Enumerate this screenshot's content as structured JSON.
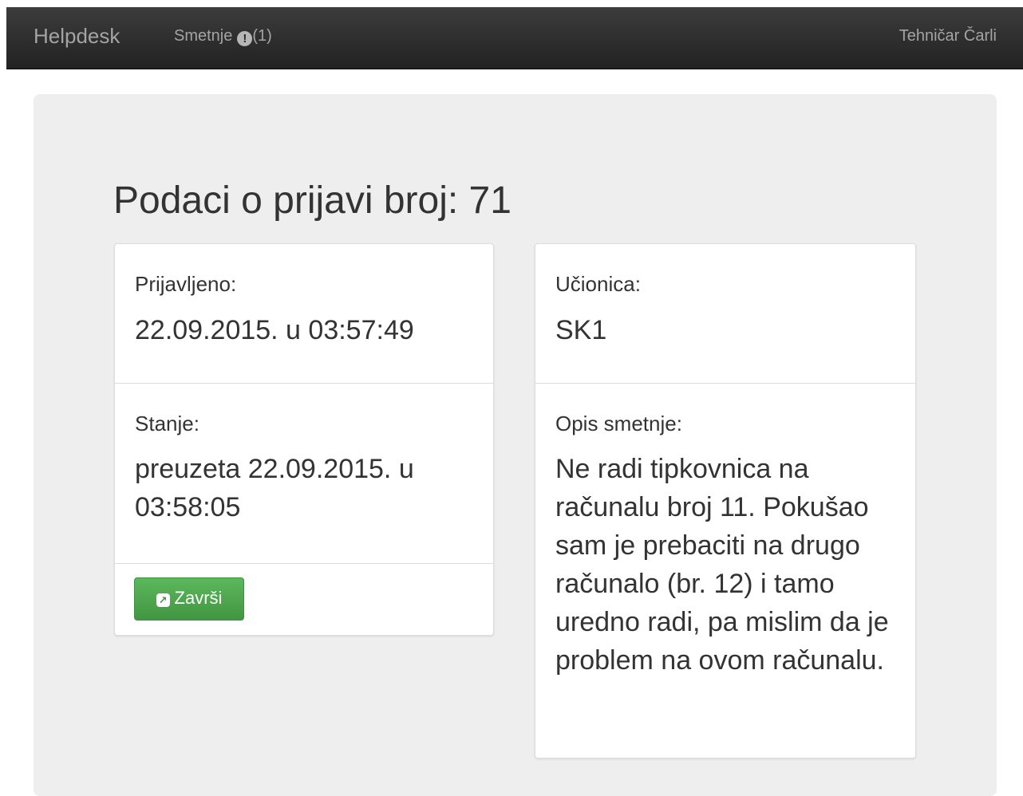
{
  "navbar": {
    "brand": "Helpdesk",
    "nav_link_label": "Smetnje",
    "nav_link_icon": "exclamation-circle-icon",
    "nav_link_count": "(1)",
    "user_name": "Tehničar Čarli"
  },
  "page": {
    "title": "Podaci o prijavi broj: 71"
  },
  "left_panel": {
    "reported_label": "Prijavljeno:",
    "reported_value": "22.09.2015. u 03:57:49",
    "state_label": "Stanje:",
    "state_value": "preuzeta 22.09.2015. u 03:58:05",
    "finish_button_icon": "share-square-icon",
    "finish_button_label": "Završi"
  },
  "right_panel": {
    "classroom_label": "Učionica:",
    "classroom_value": "SK1",
    "description_label": "Opis smetnje:",
    "description_value": "Ne radi tipkovnica na računalu broj 11. Pokušao sam je prebaciti na drugo računalo (br. 12) i tamo uredno radi, pa mislim da je problem na ovom računalu."
  },
  "colors": {
    "navbar_bg": "#222222",
    "jumbotron_bg": "#eeeeee",
    "success_button": "#5cb85c"
  }
}
